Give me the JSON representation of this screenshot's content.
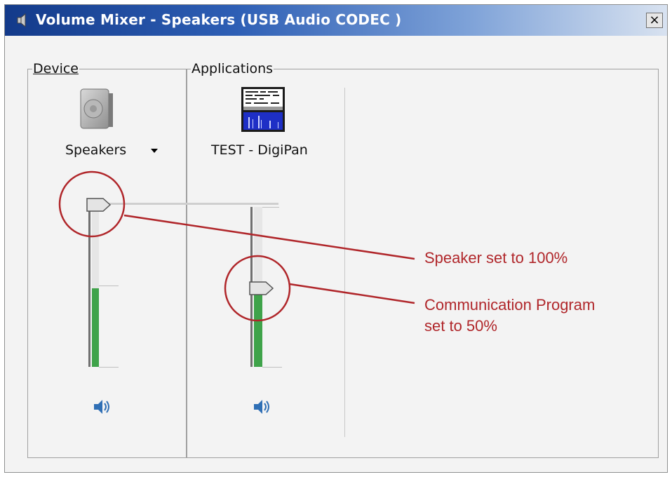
{
  "window": {
    "title": "Volume Mixer - Speakers (USB Audio CODEC )",
    "close_label": "×"
  },
  "device": {
    "legend": "Device",
    "name": "Speakers",
    "volume_percent": 100,
    "icon": "speaker-device-icon",
    "mute_icon": "speaker-volume-icon"
  },
  "applications": {
    "legend": "Applications",
    "items": [
      {
        "name": "TEST - DigiPan",
        "volume_percent": 50,
        "icon": "digipan-app-icon",
        "mute_icon": "speaker-volume-icon"
      }
    ]
  },
  "annotations": [
    {
      "text": "Speaker set to 100%"
    },
    {
      "text_line1": "Communication Program",
      "text_line2": "set to 50%"
    }
  ],
  "colors": {
    "title_bar_start": "#133a8a",
    "annotation_red": "#b0262a",
    "meter_green": "#3fa34a"
  }
}
